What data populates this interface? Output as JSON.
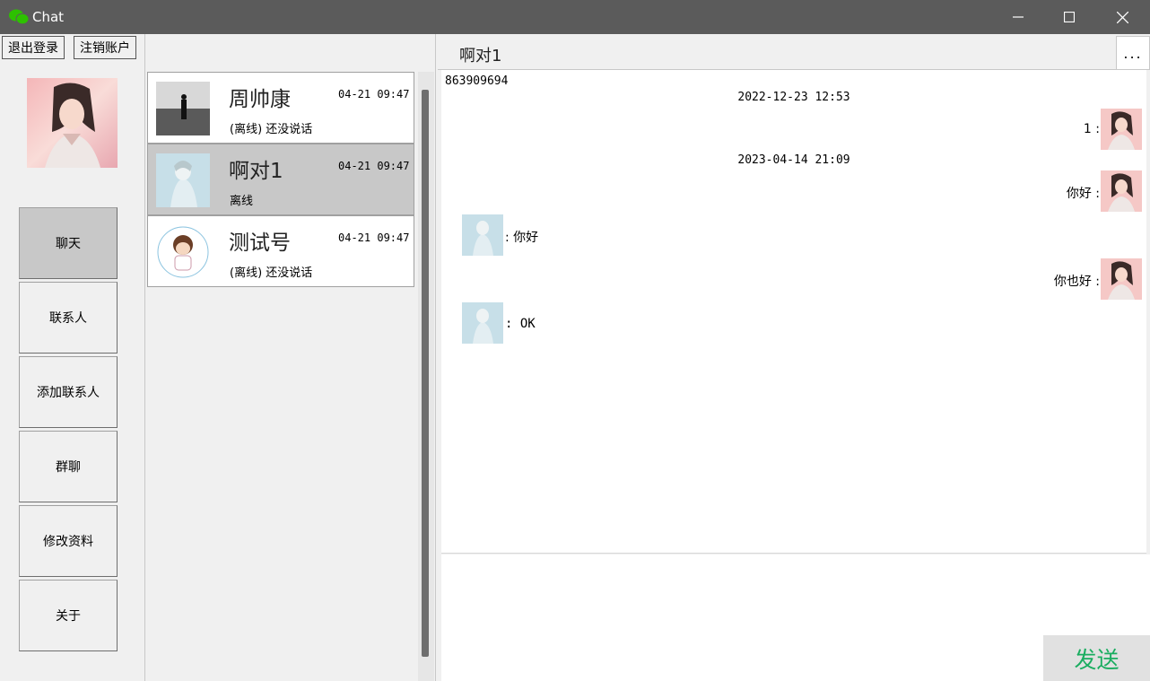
{
  "window": {
    "title": "Chat",
    "icons": {
      "app": "wechat-icon",
      "minimize": "minimize-icon",
      "maximize": "maximize-icon",
      "close": "close-icon"
    }
  },
  "sidebar": {
    "logout_label": "退出登录",
    "deregister_label": "注销账户",
    "nav": [
      {
        "label": "聊天",
        "active": true
      },
      {
        "label": "联系人",
        "active": false
      },
      {
        "label": "添加联系人",
        "active": false
      },
      {
        "label": "群聊",
        "active": false
      },
      {
        "label": "修改资料",
        "active": false
      },
      {
        "label": "关于",
        "active": false
      }
    ]
  },
  "contacts": [
    {
      "name": "周帅康",
      "time": "04-21 09:47",
      "status": "(离线)  还没说话",
      "selected": false
    },
    {
      "name": "啊对1",
      "time": "04-21 09:47",
      "status": "离线",
      "selected": true
    },
    {
      "name": "测试号",
      "time": "04-21 09:47",
      "status": "(离线)  还没说话",
      "selected": false
    }
  ],
  "chat": {
    "title": "啊对1",
    "more_label": "...",
    "id_line": "863909694",
    "timestamps": [
      "2022-12-23 12:53",
      "2023-04-14 21:09"
    ],
    "messages": [
      {
        "side": "right",
        "text": "1 :"
      },
      {
        "side": "right",
        "text": "你好 :"
      },
      {
        "side": "left",
        "text": ": 你好"
      },
      {
        "side": "right",
        "text": "你也好 :"
      },
      {
        "side": "left",
        "text": ": OK"
      }
    ],
    "send_label": "发送"
  },
  "colors": {
    "titlebar": "#5b5b5b",
    "send_text": "#1aad60",
    "selected": "#c8c8c8"
  }
}
